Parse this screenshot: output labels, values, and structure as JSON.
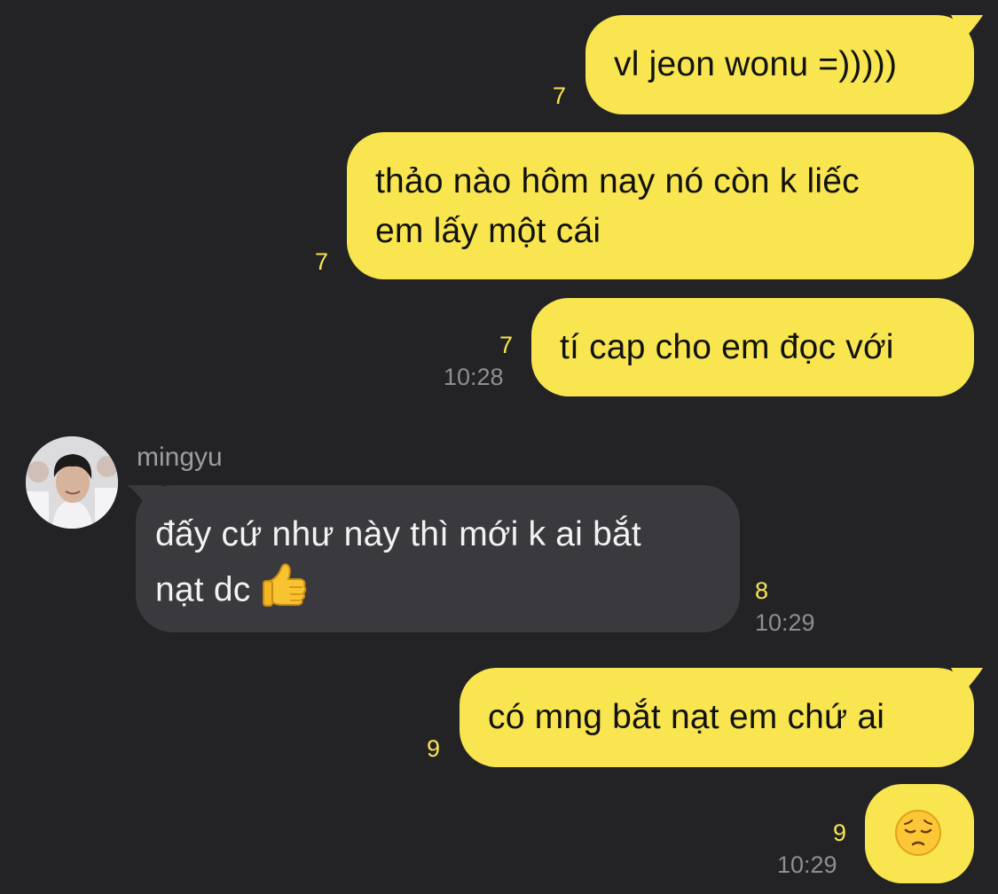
{
  "colors": {
    "background": "#232325",
    "outgoing_bubble": "#f8e54f",
    "incoming_bubble": "#3a393e",
    "unread_count": "#f8e54f",
    "timestamp": "#8e8e93"
  },
  "messages": [
    {
      "id": "m1",
      "direction": "outgoing",
      "text": "vl jeon wonu =)))))",
      "unread_count": "7",
      "time": ""
    },
    {
      "id": "m2",
      "direction": "outgoing",
      "line1": "thảo nào hôm nay nó còn k liếc",
      "line2": "em lấy một cái",
      "unread_count": "7",
      "time": ""
    },
    {
      "id": "m3",
      "direction": "outgoing",
      "text": "tí cap cho em đọc với",
      "unread_count": "7",
      "time": "10:28"
    },
    {
      "id": "m4",
      "direction": "incoming",
      "sender": "mingyu",
      "line1": "đấy cứ như này thì mới k ai bắt",
      "line2": "nạt dc",
      "emoji": "thumbs-up",
      "unread_count": "8",
      "time": "10:29"
    },
    {
      "id": "m5",
      "direction": "outgoing",
      "text": "có mng bắt nạt em chứ ai",
      "unread_count": "9",
      "time": ""
    },
    {
      "id": "m6",
      "direction": "outgoing",
      "emoji": "pensive-face",
      "unread_count": "9",
      "time": "10:29"
    }
  ]
}
